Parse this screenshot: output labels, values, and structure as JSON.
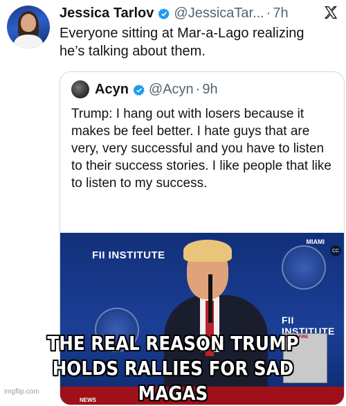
{
  "tweet": {
    "display_name": "Jessica Tarlov",
    "handle": "@JessicaTar...",
    "separator": "·",
    "time": "7h",
    "text": "Everyone sitting at Mar-a-Lago realizing he’s talking about them.",
    "verified_color": "#1d9bf0"
  },
  "quote": {
    "display_name": "Acyn",
    "handle": "@Acyn",
    "separator": "·",
    "time": "9h",
    "text": "Trump: I hang out with losers because it makes be feel better. I hate guys that are very, very successful and you have to listen to their success stories. I like people that like to listen to my success."
  },
  "video": {
    "logo_text": "INSTITUTE",
    "logo_prefix": "FII",
    "location": "MIAMI",
    "news_label": "NEWS",
    "inset_label": "FIGHT FIRE"
  },
  "meme": {
    "caption_line1": "THE REAL REASON TRUMP",
    "caption_line2": "HOLDS RALLIES FOR SAD MAGAS",
    "watermark": "imgflip.com"
  },
  "icons": {
    "verified": "verified-badge-icon",
    "x_logo": "x-logo-icon",
    "captions": "closed-captions-icon"
  }
}
